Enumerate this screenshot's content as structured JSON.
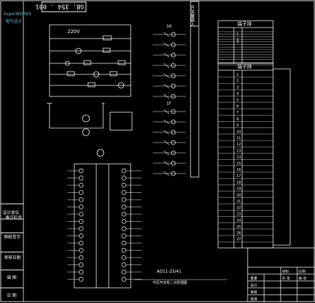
{
  "stamp_text": "GB. 354 . 001",
  "brand_line1": "SuperWORKS",
  "brand_line2": "电气设计",
  "voltage_label": "220V",
  "bus_label": "零",
  "vertical_box_label": "开关量输入",
  "relay_groups": [
    "1K",
    "1F"
  ],
  "terminal_header_top": "端子排",
  "terminal_header_mid": "端子排",
  "terminal_rows_top": [
    "",
    "",
    "1",
    "",
    "2",
    "3",
    "",
    "",
    "",
    "",
    "",
    "",
    "",
    ""
  ],
  "terminal_rows_mid": [
    "1",
    "2",
    "3",
    "4",
    "5",
    "6",
    "7",
    "8",
    "9",
    "10",
    "11",
    "12",
    "13",
    "14",
    "15",
    "16",
    "17",
    "18",
    "19",
    "20",
    "21",
    "22",
    "23",
    "24",
    "25",
    "26",
    "27"
  ],
  "device_label": "AD11-25/41",
  "left_titles": [
    "设计单位",
    "备注栏目",
    "图纸签字",
    "审核日期",
    "描 图",
    "日 期"
  ],
  "title_block": {
    "bottom_caption": "中压开关柜二次原理图",
    "cells": [
      "材料",
      "比例",
      "重量",
      "共 张",
      "第 张",
      "设计",
      "审核",
      "批准"
    ]
  }
}
